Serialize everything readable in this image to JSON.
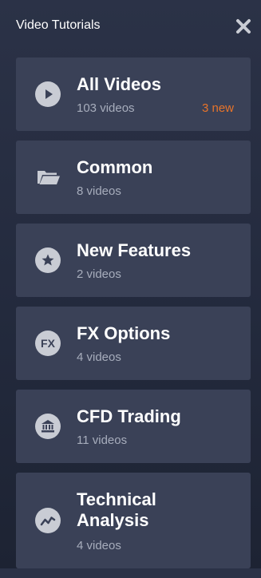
{
  "header": {
    "title": "Video Tutorials",
    "close_icon": "close-icon"
  },
  "categories": [
    {
      "title": "All Videos",
      "count": "103 videos",
      "badge": "3 new",
      "icon": "play-icon"
    },
    {
      "title": "Common",
      "count": "8 videos",
      "icon": "folder-icon"
    },
    {
      "title": "New Features",
      "count": "2 videos",
      "icon": "star-icon"
    },
    {
      "title": "FX Options",
      "count": "4 videos",
      "icon": "fx-icon",
      "icon_text": "FX"
    },
    {
      "title": "CFD Trading",
      "count": "11 videos",
      "icon": "bank-icon"
    },
    {
      "title": "Technical Analysis",
      "count": "4 videos",
      "icon": "trend-chart-icon"
    }
  ],
  "colors": {
    "card_background": "#3a4157",
    "badge": "#e8742a",
    "icon": "#c9ccd4",
    "subtext": "#a7adbc"
  }
}
